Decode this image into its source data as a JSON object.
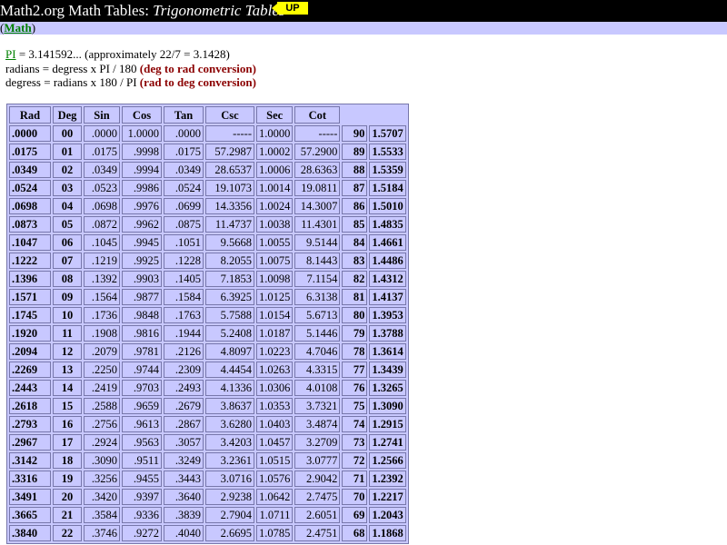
{
  "header": {
    "title_plain": "Math2.org Math Tables: ",
    "title_italic": "Trigonometric Tables",
    "up_label": "UP"
  },
  "nav": {
    "open_paren": "(",
    "link_label": "Math",
    "close_paren": ")"
  },
  "info": {
    "pi_link": "PI",
    "pi_text": " = 3.141592... (approximately 22/7 = 3.1428)",
    "rad_formula": "radians = degress x PI / 180 ",
    "rad_note": "(deg to rad conversion)",
    "deg_formula": "degress = radians x 180 / PI ",
    "deg_note": "(rad to deg conversion)"
  },
  "table": {
    "headers": [
      "Rad",
      "Deg",
      "Sin",
      "Cos",
      "Tan",
      "Csc",
      "Sec",
      "Cot"
    ],
    "rows": [
      [
        ".0000",
        "00",
        ".0000",
        "1.0000",
        ".0000",
        "-----",
        "1.0000",
        "-----",
        "90",
        "1.5707"
      ],
      [
        ".0175",
        "01",
        ".0175",
        ".9998",
        ".0175",
        "57.2987",
        "1.0002",
        "57.2900",
        "89",
        "1.5533"
      ],
      [
        ".0349",
        "02",
        ".0349",
        ".9994",
        ".0349",
        "28.6537",
        "1.0006",
        "28.6363",
        "88",
        "1.5359"
      ],
      [
        ".0524",
        "03",
        ".0523",
        ".9986",
        ".0524",
        "19.1073",
        "1.0014",
        "19.0811",
        "87",
        "1.5184"
      ],
      [
        ".0698",
        "04",
        ".0698",
        ".9976",
        ".0699",
        "14.3356",
        "1.0024",
        "14.3007",
        "86",
        "1.5010"
      ],
      [
        ".0873",
        "05",
        ".0872",
        ".9962",
        ".0875",
        "11.4737",
        "1.0038",
        "11.4301",
        "85",
        "1.4835"
      ],
      [
        ".1047",
        "06",
        ".1045",
        ".9945",
        ".1051",
        "9.5668",
        "1.0055",
        "9.5144",
        "84",
        "1.4661"
      ],
      [
        ".1222",
        "07",
        ".1219",
        ".9925",
        ".1228",
        "8.2055",
        "1.0075",
        "8.1443",
        "83",
        "1.4486"
      ],
      [
        ".1396",
        "08",
        ".1392",
        ".9903",
        ".1405",
        "7.1853",
        "1.0098",
        "7.1154",
        "82",
        "1.4312"
      ],
      [
        ".1571",
        "09",
        ".1564",
        ".9877",
        ".1584",
        "6.3925",
        "1.0125",
        "6.3138",
        "81",
        "1.4137"
      ],
      [
        ".1745",
        "10",
        ".1736",
        ".9848",
        ".1763",
        "5.7588",
        "1.0154",
        "5.6713",
        "80",
        "1.3953"
      ],
      [
        ".1920",
        "11",
        ".1908",
        ".9816",
        ".1944",
        "5.2408",
        "1.0187",
        "5.1446",
        "79",
        "1.3788"
      ],
      [
        ".2094",
        "12",
        ".2079",
        ".9781",
        ".2126",
        "4.8097",
        "1.0223",
        "4.7046",
        "78",
        "1.3614"
      ],
      [
        ".2269",
        "13",
        ".2250",
        ".9744",
        ".2309",
        "4.4454",
        "1.0263",
        "4.3315",
        "77",
        "1.3439"
      ],
      [
        ".2443",
        "14",
        ".2419",
        ".9703",
        ".2493",
        "4.1336",
        "1.0306",
        "4.0108",
        "76",
        "1.3265"
      ],
      [
        ".2618",
        "15",
        ".2588",
        ".9659",
        ".2679",
        "3.8637",
        "1.0353",
        "3.7321",
        "75",
        "1.3090"
      ],
      [
        ".2793",
        "16",
        ".2756",
        ".9613",
        ".2867",
        "3.6280",
        "1.0403",
        "3.4874",
        "74",
        "1.2915"
      ],
      [
        ".2967",
        "17",
        ".2924",
        ".9563",
        ".3057",
        "3.4203",
        "1.0457",
        "3.2709",
        "73",
        "1.2741"
      ],
      [
        ".3142",
        "18",
        ".3090",
        ".9511",
        ".3249",
        "3.2361",
        "1.0515",
        "3.0777",
        "72",
        "1.2566"
      ],
      [
        ".3316",
        "19",
        ".3256",
        ".9455",
        ".3443",
        "3.0716",
        "1.0576",
        "2.9042",
        "71",
        "1.2392"
      ],
      [
        ".3491",
        "20",
        ".3420",
        ".9397",
        ".3640",
        "2.9238",
        "1.0642",
        "2.7475",
        "70",
        "1.2217"
      ],
      [
        ".3665",
        "21",
        ".3584",
        ".9336",
        ".3839",
        "2.7904",
        "1.0711",
        "2.6051",
        "69",
        "1.2043"
      ],
      [
        ".3840",
        "22",
        ".3746",
        ".9272",
        ".4040",
        "2.6695",
        "1.0785",
        "2.4751",
        "68",
        "1.1868"
      ]
    ]
  },
  "colors": {
    "topbar": "#000000",
    "navbar": "#c8c8ff",
    "table_bg": "#c8c8ff",
    "link": "#008000",
    "note": "#8b0000",
    "up_button": "#ffff00"
  }
}
